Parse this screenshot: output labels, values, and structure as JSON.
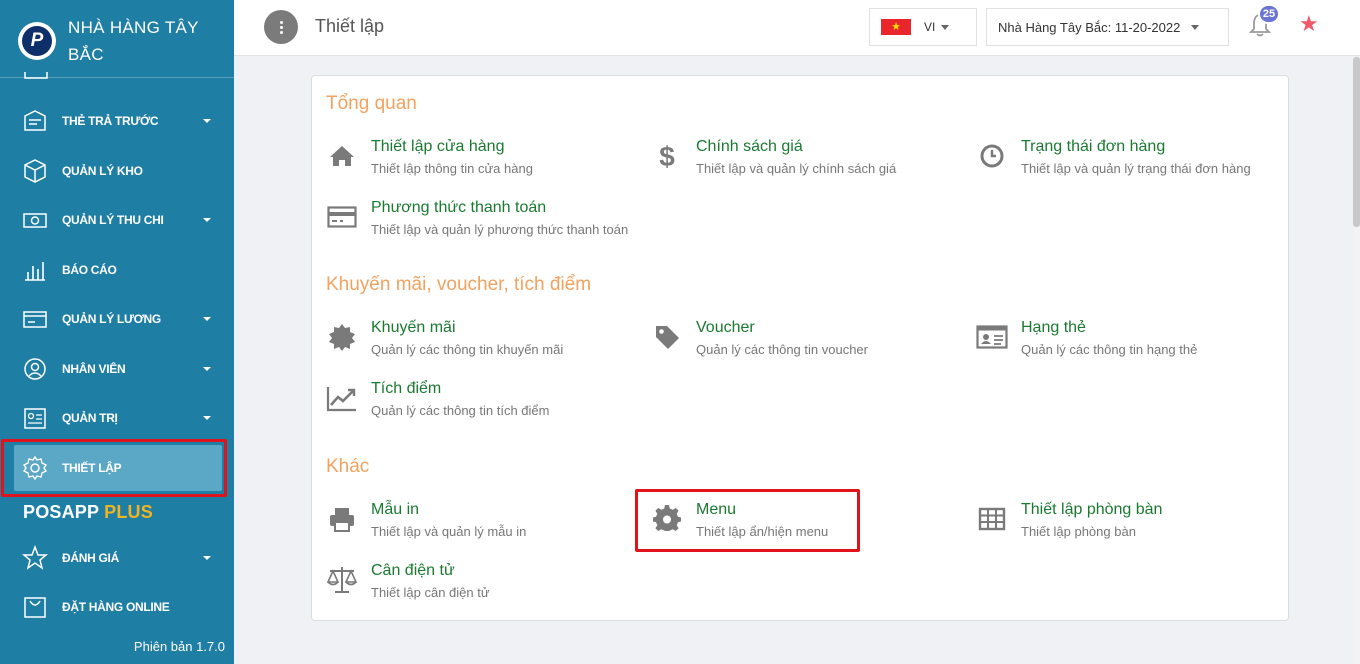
{
  "brand": {
    "logo_letter": "P",
    "name": "NHÀ HÀNG TÂY BẮC"
  },
  "sidebar": {
    "items": [
      {
        "label": "THẺ TRẢ TRƯỚC",
        "icon": "prepaid-card-icon",
        "has_caret": true
      },
      {
        "label": "QUẢN LÝ KHO",
        "icon": "warehouse-box-icon",
        "has_caret": false
      },
      {
        "label": "QUẢN LÝ THU CHI",
        "icon": "cash-icon",
        "has_caret": true
      },
      {
        "label": "BÁO CÁO",
        "icon": "bar-chart-icon",
        "has_caret": false
      },
      {
        "label": "QUẢN LÝ LƯƠNG",
        "icon": "payroll-card-icon",
        "has_caret": true
      },
      {
        "label": "NHÂN VIÊN",
        "icon": "user-icon",
        "has_caret": true
      },
      {
        "label": "QUẢN TRỊ",
        "icon": "admin-id-icon",
        "has_caret": true
      },
      {
        "label": "THIẾT LẬP",
        "icon": "gear-icon",
        "has_caret": false,
        "active": true
      }
    ],
    "posapp": {
      "text": "POSAPP",
      "plus": "PLUS"
    },
    "bottom_items": [
      {
        "label": "ĐÁNH GIÁ",
        "icon": "star-outline-icon",
        "has_caret": true
      },
      {
        "label": "ĐẶT HÀNG ONLINE",
        "icon": "shopping-bag-icon",
        "has_caret": false
      }
    ],
    "version": "Phiên bản 1.7.0"
  },
  "header": {
    "title": "Thiết lập",
    "language": "VI",
    "store_select": "Nhà Hàng Tây Bắc: 11-20-2022",
    "notification_count": "25"
  },
  "sections": [
    {
      "title": "Tổng quan",
      "items": [
        {
          "title": "Thiết lập cửa hàng",
          "desc": "Thiết lập thông tin cửa hàng",
          "icon": "home-icon"
        },
        {
          "title": "Chính sách giá",
          "desc": "Thiết lập và quản lý chính sách giá",
          "icon": "dollar-icon"
        },
        {
          "title": "Trạng thái đơn hàng",
          "desc": "Thiết lập và quản lý trạng thái đơn hàng",
          "icon": "clock-icon"
        },
        {
          "title": "Phương thức thanh toán",
          "desc": "Thiết lập và quản lý phương thức thanh toán",
          "icon": "credit-card-icon"
        }
      ]
    },
    {
      "title": "Khuyến mãi, voucher, tích điểm",
      "items": [
        {
          "title": "Khuyến mãi",
          "desc": "Quản lý các thông tin khuyến mãi",
          "icon": "promo-badge-icon"
        },
        {
          "title": "Voucher",
          "desc": "Quản lý các thông tin voucher",
          "icon": "tag-icon"
        },
        {
          "title": "Hạng thẻ",
          "desc": "Quản lý các thông tin hạng thẻ",
          "icon": "id-card-icon"
        },
        {
          "title": "Tích điểm",
          "desc": "Quản lý các thông tin tích điểm",
          "icon": "trend-chart-icon"
        }
      ]
    },
    {
      "title": "Khác",
      "items": [
        {
          "title": "Mẫu in",
          "desc": "Thiết lập và quản lý mẫu in",
          "icon": "printer-icon"
        },
        {
          "title": "Menu",
          "desc": "Thiết lập ẩn/hiện menu",
          "icon": "gear-icon",
          "highlighted": true
        },
        {
          "title": "Thiết lập phòng bàn",
          "desc": "Thiết lập phòng bàn",
          "icon": "table-grid-icon"
        },
        {
          "title": "Cân điện tử",
          "desc": "Thiết lập cân điện tử",
          "icon": "scale-icon"
        }
      ]
    }
  ],
  "colors": {
    "sidebar_bg": "#1f7ea4",
    "active_item_bg": "#5ba7c6",
    "section_title": "#f3a25f",
    "item_title": "#1b7a31",
    "highlight_box": "#e0121c",
    "plus": "#f0b323"
  }
}
